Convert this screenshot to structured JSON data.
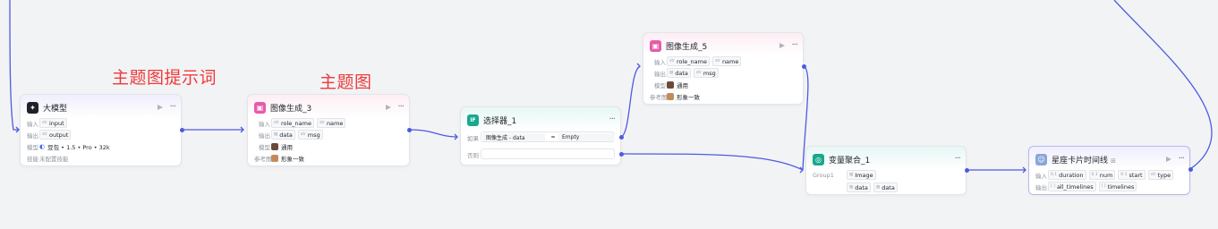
{
  "annotations": {
    "prompt_label": "主题图提示词",
    "image_label": "主题图"
  },
  "colors": {
    "edge": "#4e5ae0",
    "annotation": "#ee3a3a"
  },
  "nodes": {
    "llm": {
      "title": "大模型",
      "icon": "llm-icon",
      "input_label": "输入",
      "input_var": "input",
      "output_label": "输出",
      "output_var": "output",
      "model_label": "模型",
      "model_value": "豆包 • 1.5 • Pro • 32k",
      "skill_label": "技能",
      "skill_value": "未配置技能"
    },
    "img3": {
      "title": "图像生成_3",
      "input_label": "输入",
      "inputs": [
        "role_name",
        "name"
      ],
      "output_label": "输出",
      "outputs": [
        "data",
        "msg"
      ],
      "model_label": "模型",
      "model_value": "通用",
      "ref_label": "参考图",
      "ref_value": "形象一致"
    },
    "selector": {
      "title": "选择器_1",
      "if_label": "如果",
      "left_operand": "图像生成 - data",
      "operator": "=",
      "right_operand": "Empty",
      "else_label": "否则"
    },
    "img5": {
      "title": "图像生成_5",
      "input_label": "输入",
      "inputs": [
        "role_name",
        "name"
      ],
      "output_label": "输出",
      "outputs": [
        "data",
        "msg"
      ],
      "model_label": "模型",
      "model_value": "通用",
      "ref_label": "参考图",
      "ref_value": "形象一致"
    },
    "agg": {
      "title": "变量聚合_1",
      "group_label": "Group1",
      "group_var": "Image",
      "vars": [
        "data",
        "data"
      ]
    },
    "timeline": {
      "title": "星座卡片时间线",
      "input_label": "输入",
      "inputs": [
        "duration",
        "num",
        "start",
        "type"
      ],
      "output_label": "输出",
      "outputs": [
        "all_timelines",
        "timelines"
      ]
    }
  }
}
